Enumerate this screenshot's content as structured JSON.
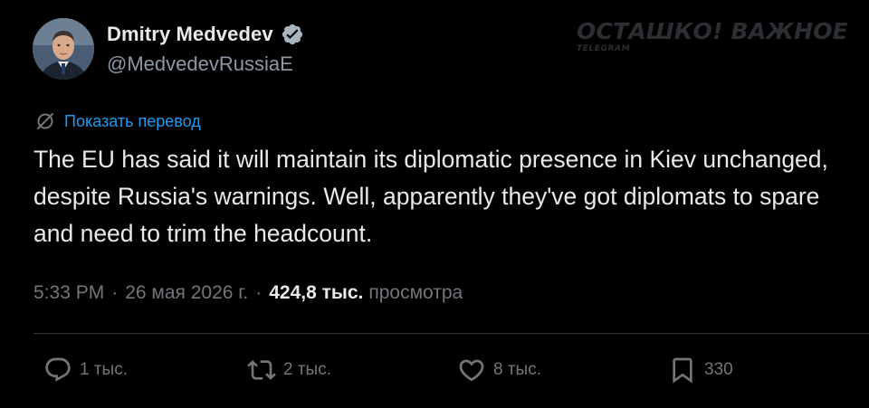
{
  "author": {
    "display_name": "Dmitry Medvedev",
    "handle": "@MedvedevRussiaE",
    "verified": true
  },
  "watermark": {
    "main": "ОСТАШКО! ВАЖНОЕ",
    "sub": "TELEGRAM"
  },
  "translate": {
    "label": "Показать перевод"
  },
  "tweet": {
    "text": "The EU has said it will maintain its diplomatic presence in Kiev unchanged, despite Russia's warnings. Well, apparently they've got diplomats to spare and need to trim the headcount."
  },
  "meta": {
    "time": "5:33 PM",
    "date": "26 мая 2026 г.",
    "views_count": "424,8 тыс.",
    "views_label": "просмотра"
  },
  "actions": {
    "replies": "1 тыс.",
    "reposts": "2 тыс.",
    "likes": "8 тыс.",
    "bookmarks": "330"
  },
  "colors": {
    "background": "#000000",
    "text": "#e7e9ea",
    "muted": "#71767b",
    "accent": "#1d9bf0",
    "divider": "#2f3336"
  }
}
